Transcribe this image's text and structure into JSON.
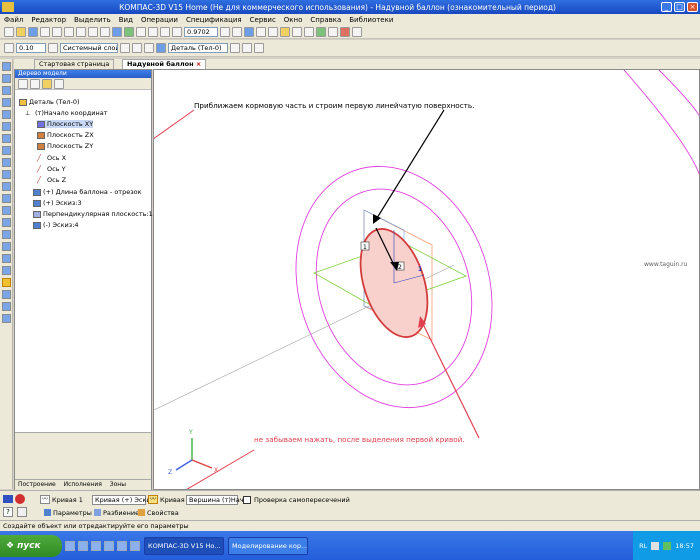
{
  "window": {
    "title": "КОМПАС-3D V15 Home (Не для коммерческого использования) - Надувной баллон (ознакомительный период)"
  },
  "menu": [
    "Файл",
    "Редактор",
    "Выделить",
    "Вид",
    "Операции",
    "Спецификация",
    "Сервис",
    "Окно",
    "Справка",
    "Библиотеки"
  ],
  "toolbar2": {
    "line_width": "0.10",
    "layer": "Системный слой (0)",
    "zoom": "0.9702",
    "part": "Деталь (Тел-0)"
  },
  "tabs": [
    {
      "label": "Стартовая страница"
    },
    {
      "label": "Надувной баллон"
    }
  ],
  "tree_panel": {
    "title": "Дерево модели",
    "items": [
      "Деталь (Тел-0)",
      "(т)Начало координат",
      "Плоскость XY",
      "Плоскость ZX",
      "Плоскость ZY",
      "Ось X",
      "Ось Y",
      "Ось Z",
      "(+) Длина баллона - отрезок",
      "(+) Эскиз:3",
      "Перпендикулярная плоскость:1",
      "(-) Эскиз:4"
    ],
    "bottom_tabs": [
      "Построение",
      "Исполнения",
      "Зоны"
    ]
  },
  "viewport": {
    "annotation_top": "Приближаем кормовую часть и строим первую линейчатую поверхность.",
    "annotation_bottom": "не забываем нажать, после выделения первой кривой.",
    "point_labels": [
      "1",
      "2"
    ],
    "curve_label": "1",
    "axes": [
      "Y",
      "X",
      "Z"
    ],
    "watermark": "www.taguin.ru",
    "colors": {
      "annotation_arrow": "#e04050",
      "ellipse": "#d43c3c",
      "circles": "#e040e0",
      "plane_green": "#80d040",
      "plane_orange": "#f0a070"
    }
  },
  "propbar": {
    "curve1_label": "Кривая 1",
    "curve1_value": "Кривая (+) Эскиз",
    "curve2_label": "Кривая 2",
    "vertex_value": "Вершина (т)Нача",
    "self_intersect_label": "Проверка самопересечений",
    "tabs": [
      "Параметры",
      "Разбиение",
      "Свойства"
    ]
  },
  "status_text": "Создайте объект или отредактируйте его параметры",
  "taskbar": {
    "start": "пуск",
    "tasks": [
      "КОМПАС-3D V15 Ho...",
      "Моделирование кор..."
    ],
    "lang": "RL",
    "time": "18:57"
  }
}
